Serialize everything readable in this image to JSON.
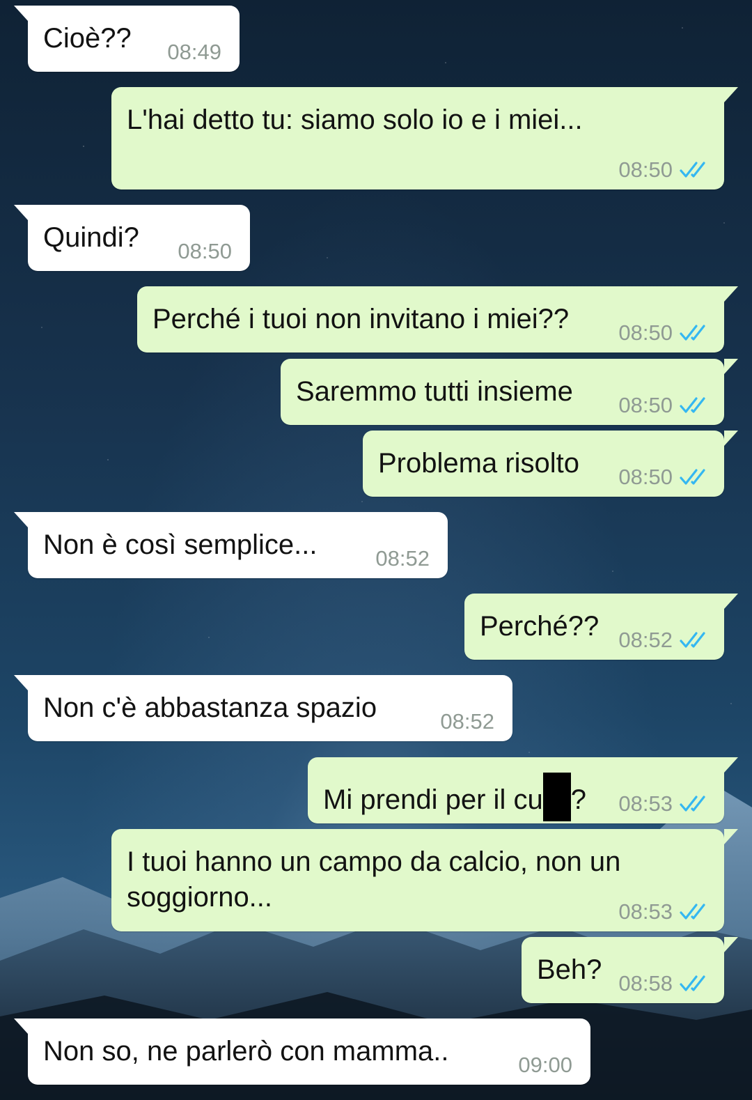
{
  "colors": {
    "incoming_bubble": "#ffffff",
    "outgoing_bubble": "#e1f9cb",
    "timestamp_text": "#8f9a93",
    "read_ticks": "#34b7f1"
  },
  "icons": {
    "read_receipt": "double-check-icon"
  },
  "messages": [
    {
      "direction": "in",
      "text": "Cioè??",
      "time": "08:49"
    },
    {
      "direction": "out",
      "text": "L'hai detto tu: siamo solo io e i miei...",
      "time": "08:50",
      "status": "read"
    },
    {
      "direction": "in",
      "text": "Quindi?",
      "time": "08:50"
    },
    {
      "direction": "out",
      "text": "Perché i tuoi non invitano i miei??",
      "time": "08:50",
      "status": "read"
    },
    {
      "direction": "out",
      "text": "Saremmo tutti insieme",
      "time": "08:50",
      "status": "read"
    },
    {
      "direction": "out",
      "text": "Problema risolto",
      "time": "08:50",
      "status": "read"
    },
    {
      "direction": "in",
      "text": "Non è così semplice...",
      "time": "08:52"
    },
    {
      "direction": "out",
      "text": "Perché??",
      "time": "08:52",
      "status": "read"
    },
    {
      "direction": "in",
      "text": "Non c'è abbastanza spazio",
      "time": "08:52"
    },
    {
      "direction": "out",
      "text_before_redaction": "Mi prendi per il cu",
      "text_after_redaction": "?",
      "redacted": true,
      "time": "08:53",
      "status": "read"
    },
    {
      "direction": "out",
      "text": "I tuoi hanno un campo da calcio, non un\nsoggiorno...",
      "time": "08:53",
      "status": "read"
    },
    {
      "direction": "out",
      "text": "Beh?",
      "time": "08:58",
      "status": "read"
    },
    {
      "direction": "in",
      "text": "Non so, ne parlerò con mamma..",
      "time": "09:00"
    }
  ]
}
